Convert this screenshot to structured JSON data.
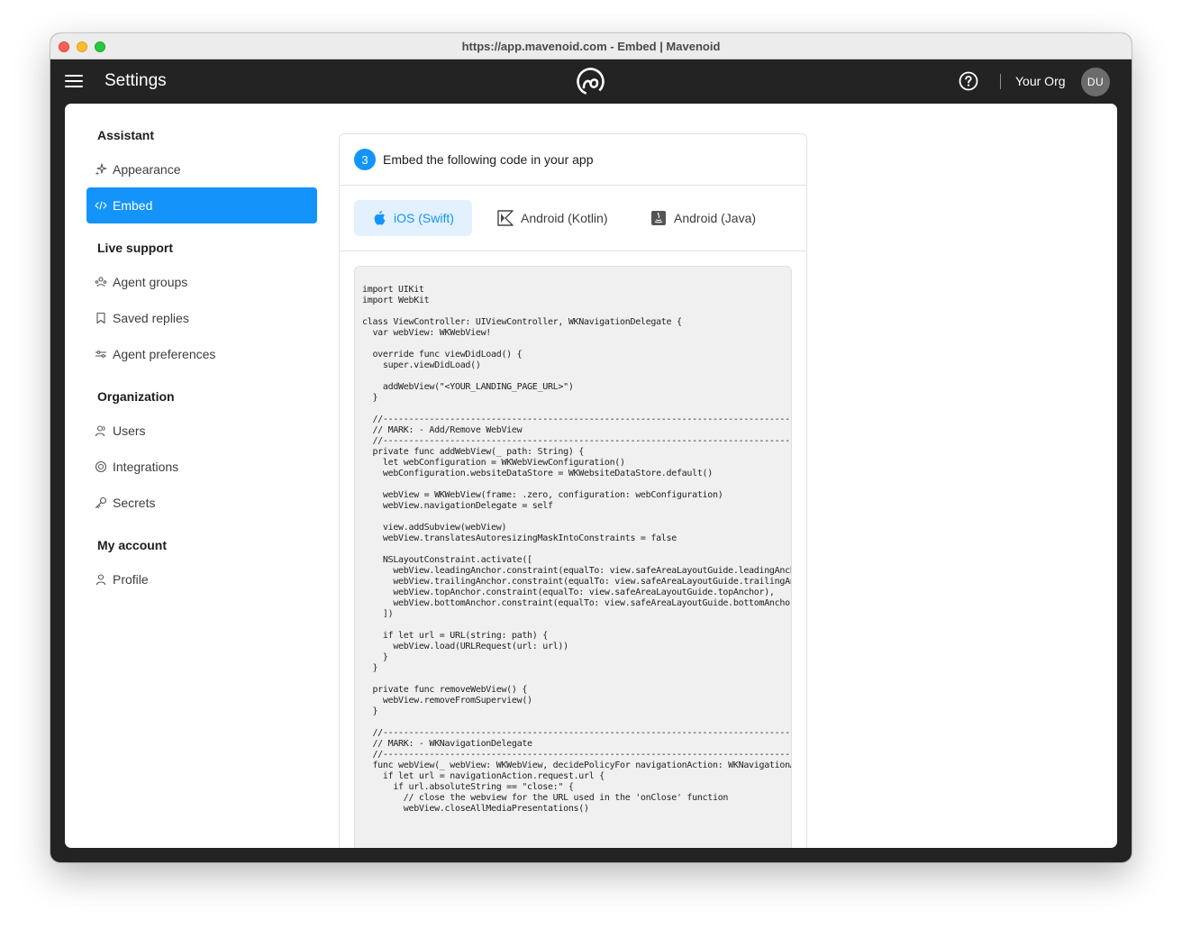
{
  "window": {
    "title": "https://app.mavenoid.com - Embed | Mavenoid"
  },
  "appbar": {
    "title": "Settings",
    "org": "Your Org",
    "avatar_initials": "DU"
  },
  "sidebar": {
    "sections": [
      {
        "title": "Assistant",
        "items": [
          {
            "label": "Appearance",
            "icon": "sparkles-icon"
          },
          {
            "label": "Embed",
            "icon": "code-icon",
            "active": true
          }
        ]
      },
      {
        "title": "Live support",
        "items": [
          {
            "label": "Agent groups",
            "icon": "agent-groups-icon"
          },
          {
            "label": "Saved replies",
            "icon": "bookmark-icon"
          },
          {
            "label": "Agent preferences",
            "icon": "sliders-icon"
          }
        ]
      },
      {
        "title": "Organization",
        "items": [
          {
            "label": "Users",
            "icon": "users-icon"
          },
          {
            "label": "Integrations",
            "icon": "integrations-icon"
          },
          {
            "label": "Secrets",
            "icon": "key-icon"
          }
        ]
      },
      {
        "title": "My account",
        "items": [
          {
            "label": "Profile",
            "icon": "person-icon"
          }
        ]
      }
    ]
  },
  "panel": {
    "step": "3",
    "title": "Embed the following code in your app",
    "tabs": [
      {
        "label": "iOS (Swift)",
        "icon": "apple-icon",
        "active": true
      },
      {
        "label": "Android (Kotlin)",
        "icon": "kotlin-icon"
      },
      {
        "label": "Android (Java)",
        "icon": "java-icon"
      }
    ],
    "code": "import UIKit\nimport WebKit\n\nclass ViewController: UIViewController, WKNavigationDelegate {\n  var webView: WKWebView!\n\n  override func viewDidLoad() {\n    super.viewDidLoad()\n\n    addWebView(\"<YOUR_LANDING_PAGE_URL>\")\n  }\n\n  //--------------------------------------------------------------------------------\n  // MARK: - Add/Remove WebView\n  //--------------------------------------------------------------------------------\n  private func addWebView(_ path: String) {\n    let webConfiguration = WKWebViewConfiguration()\n    webConfiguration.websiteDataStore = WKWebsiteDataStore.default()\n\n    webView = WKWebView(frame: .zero, configuration: webConfiguration)\n    webView.navigationDelegate = self\n\n    view.addSubview(webView)\n    webView.translatesAutoresizingMaskIntoConstraints = false\n\n    NSLayoutConstraint.activate([\n      webView.leadingAnchor.constraint(equalTo: view.safeAreaLayoutGuide.leadingAnchor),\n      webView.trailingAnchor.constraint(equalTo: view.safeAreaLayoutGuide.trailingAnchor),\n      webView.topAnchor.constraint(equalTo: view.safeAreaLayoutGuide.topAnchor),\n      webView.bottomAnchor.constraint(equalTo: view.safeAreaLayoutGuide.bottomAnchor)\n    ])\n\n    if let url = URL(string: path) {\n      webView.load(URLRequest(url: url))\n    }\n  }\n\n  private func removeWebView() {\n    webView.removeFromSuperview()\n  }\n\n  //--------------------------------------------------------------------------------\n  // MARK: - WKNavigationDelegate\n  //--------------------------------------------------------------------------------\n  func webView(_ webView: WKWebView, decidePolicyFor navigationAction: WKNavigationAction) {\n    if let url = navigationAction.request.url {\n      if url.absoluteString == \"close:\" {\n        // close the webview for the URL used in the 'onClose' function\n        webView.closeAllMediaPresentations()"
  }
}
